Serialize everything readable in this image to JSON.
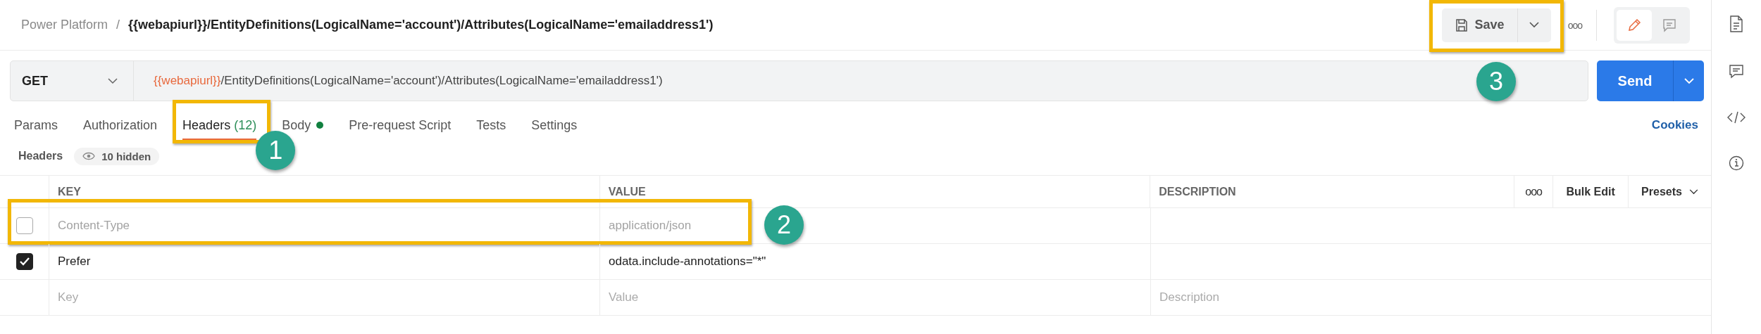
{
  "breadcrumb": {
    "collection": "Power Platform",
    "separator": "/",
    "request": "{{webapiurl}}/EntityDefinitions(LogicalName='account')/Attributes(LogicalName='emailaddress1')"
  },
  "save": {
    "label": "Save",
    "highlighted": true,
    "callout": "3"
  },
  "more": "ooo",
  "modes": [
    {
      "kind": "edit",
      "selected": true
    },
    {
      "kind": "comments",
      "selected": false
    }
  ],
  "request": {
    "method": "GET",
    "variable": "{{webapiurl}}",
    "path": "/EntityDefinitions(LogicalName='account')/Attributes(LogicalName='emailaddress1')"
  },
  "send": {
    "label": "Send"
  },
  "tabs": [
    {
      "label": "Params",
      "selected": false
    },
    {
      "label": "Authorization",
      "selected": false
    },
    {
      "label": "Headers",
      "count": "(12)",
      "selected": true,
      "highlighted": true,
      "callout": "1"
    },
    {
      "label": "Body",
      "has_content": true,
      "selected": false
    },
    {
      "label": "Pre-request Script",
      "selected": false
    },
    {
      "label": "Tests",
      "selected": false
    },
    {
      "label": "Settings",
      "selected": false
    }
  ],
  "cookies": "Cookies",
  "headers_bar": {
    "label": "Headers",
    "hidden": "10 hidden"
  },
  "table": {
    "columns": [
      "KEY",
      "VALUE",
      "DESCRIPTION"
    ],
    "more": "ooo",
    "bulk_edit": "Bulk Edit",
    "presets": "Presets",
    "rows": [
      {
        "kind": "entry",
        "key": "Content-Type",
        "value": "application/json",
        "checked": false,
        "highlighted": true,
        "callout": "2"
      },
      {
        "kind": "entry",
        "key": "Prefer",
        "value": "odata.include-annotations=\"*\"",
        "checked": true
      },
      {
        "kind": "new",
        "key_placeholder": "Key",
        "value_placeholder": "Value",
        "description_placeholder": "Description"
      }
    ]
  }
}
